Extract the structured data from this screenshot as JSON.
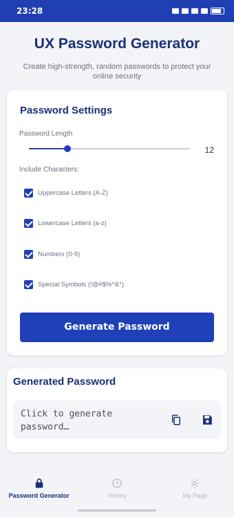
{
  "status": {
    "time": "23:28"
  },
  "header": {
    "title": "UX Password Generator",
    "subtitle": "Create high-strength, random passwords to protect your online security"
  },
  "settings": {
    "title": "Password Settings",
    "length_label": "Password Length",
    "length_value": "12",
    "length_fraction": 0.24,
    "include_label": "Include Characters:",
    "options": [
      {
        "label": "Uppercase Letters (A-Z)",
        "checked": true
      },
      {
        "label": "Lowercase Letters (a-z)",
        "checked": true
      },
      {
        "label": "Numbers (0-9)",
        "checked": true
      },
      {
        "label": "Special Symbols (!@#$%^&*)",
        "checked": true
      }
    ],
    "generate_label": "Generate Password"
  },
  "result": {
    "title": "Generated Password",
    "placeholder": "Click to generate password…",
    "copy_icon": "copy-icon",
    "save_icon": "save-icon"
  },
  "nav": {
    "items": [
      {
        "label": "Password Generator",
        "icon": "lock-icon",
        "active": true
      },
      {
        "label": "History",
        "icon": "clock-icon",
        "active": false
      },
      {
        "label": "My Page",
        "icon": "gear-icon",
        "active": false
      }
    ]
  },
  "colors": {
    "primary": "#1f3fb3",
    "title": "#1a2f7a",
    "background": "#f3f4f8"
  }
}
